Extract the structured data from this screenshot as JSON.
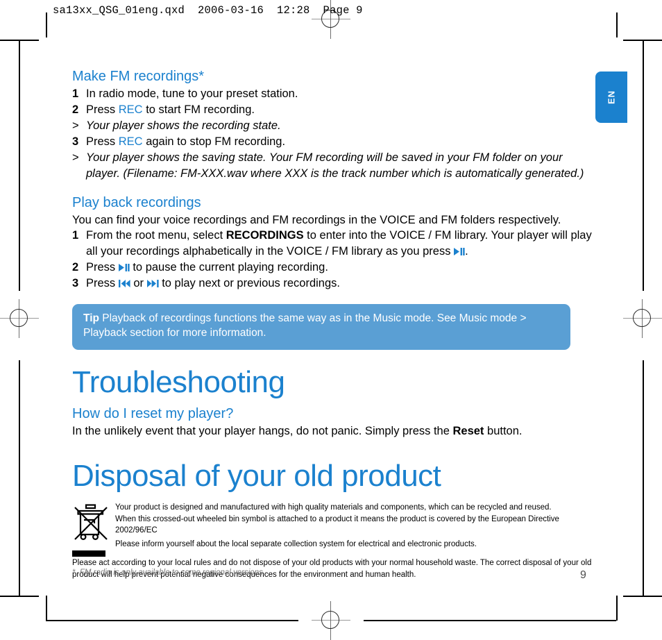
{
  "prepress": {
    "header": "sa13xx_QSG_01eng.qxd  2006-03-16  12:28  Page 9"
  },
  "language_tab": {
    "label": "EN"
  },
  "sections": {
    "fm_recordings": {
      "heading": "Make FM recordings*",
      "steps": [
        {
          "marker": "1",
          "kind": "step",
          "text": "In radio mode, tune to your preset station."
        },
        {
          "marker": "2",
          "kind": "step",
          "text_pre": "Press ",
          "emphasis": "REC",
          "text_post": " to start FM recording."
        },
        {
          "marker": ">",
          "kind": "note",
          "text": "Your player shows the recording state."
        },
        {
          "marker": "3",
          "kind": "step",
          "text_pre": "Press ",
          "emphasis": "REC",
          "text_post": " again to stop FM recording."
        },
        {
          "marker": ">",
          "kind": "note",
          "text": "Your player shows the saving state. Your FM recording will be saved in your FM folder on your player. (Filename: FM-XXX.wav where XXX is the track number which is automatically generated.)"
        }
      ]
    },
    "play_back": {
      "heading": "Play back recordings",
      "intro": "You can find your voice recordings and FM recordings in the VOICE and FM folders respectively.",
      "step1_pre": "From the root menu, select ",
      "step1_bold": "RECORDINGS",
      "step1_post": " to enter into the VOICE / FM library. Your player will play all your recordings alphabetically in the VOICE / FM library as you press ",
      "step1_end": ".",
      "step2_pre": "Press ",
      "step2_post": " to pause the current playing recording.",
      "step3_pre": "Press ",
      "step3_mid": " or ",
      "step3_post": " to play next or previous recordings.",
      "markers": {
        "one": "1",
        "two": "2",
        "three": "3"
      },
      "icons": {
        "play_pause": "play-pause-icon",
        "previous": "previous-track-icon",
        "next": "next-track-icon"
      }
    },
    "tip": {
      "label": "Tip",
      "text": " Playback of recordings functions the same way as in the Music mode. See Music mode > Playback section for more information."
    },
    "troubleshooting": {
      "title": "Troubleshooting",
      "heading": "How do I reset my player?",
      "body_pre": "In the unlikely event that your player hangs, do not panic. Simply press the ",
      "body_bold": "Reset",
      "body_post": " button."
    },
    "disposal": {
      "title": "Disposal of your old product",
      "icon": "crossed-out-wheeled-bin-icon",
      "line1": "Your product is designed and manufactured with high quality materials and components, which can be recycled and reused.",
      "line2": "When this crossed-out wheeled bin symbol is attached to a product it means the product is covered by the European Directive 2002/96/EC",
      "line3": "Please inform yourself about the local separate collection system for electrical and electronic products.",
      "line4": "Please act according to your local rules and do not dispose of your old products with your normal household waste. The correct disposal of your old product will help prevent potential negative consequences for the environment and human health."
    }
  },
  "footnote": "*  FM radio is only available to some regional versions.",
  "page_number": "9",
  "colors": {
    "philips_blue": "#1b81ce",
    "tip_blue": "#5a9fd4",
    "footnote_gray": "#7a7a7a"
  }
}
